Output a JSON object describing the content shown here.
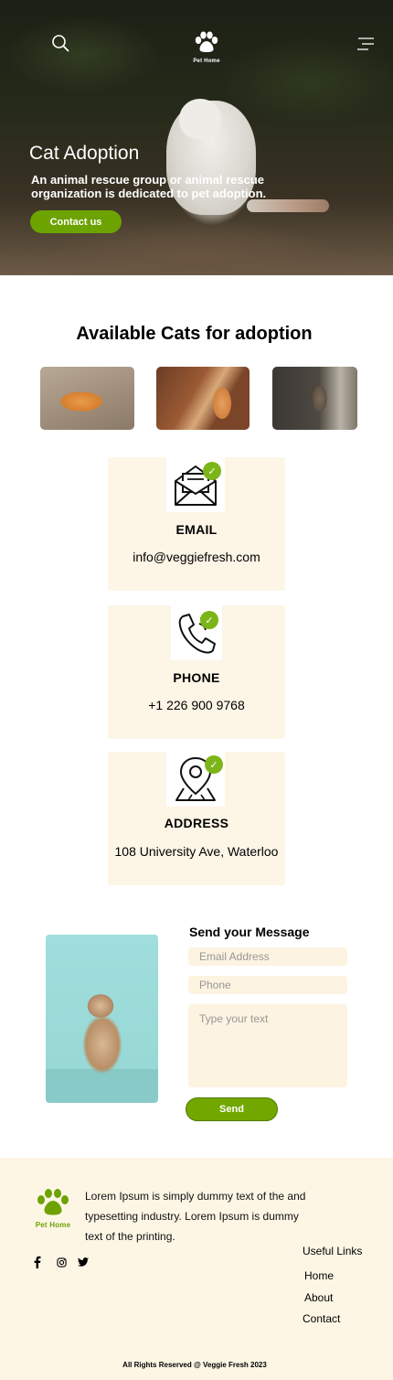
{
  "brand": {
    "name": "Pet Home"
  },
  "colors": {
    "accent": "#6ca300",
    "card_bg": "#fdf5e6",
    "footer_bg": "#fdf6e5"
  },
  "header": {
    "search_icon": "search-icon",
    "menu_icon": "hamburger-menu-icon",
    "logo_icon": "paw-icon"
  },
  "hero": {
    "title": "Cat Adoption",
    "subtitle": "An animal rescue group or animal rescue organization is dedicated to pet adoption.",
    "cta_label": "Contact us"
  },
  "adoption": {
    "title": "Available Cats for adoption"
  },
  "contact_cards": [
    {
      "icon": "envelope-icon",
      "title": "EMAIL",
      "value": "info@veggiefresh.com"
    },
    {
      "icon": "phone-icon",
      "title": "PHONE",
      "value": "+1 226 900 9768"
    },
    {
      "icon": "location-pin-icon",
      "title": "ADDRESS",
      "value": "108 University Ave, Waterloo"
    }
  ],
  "message_form": {
    "title": "Send your Message",
    "email_placeholder": "Email Address",
    "phone_placeholder": "Phone",
    "text_placeholder": "Type your text",
    "send_label": "Send"
  },
  "footer": {
    "description": "Lorem Ipsum is simply dummy text of the and typesetting industry. Lorem Ipsum is dummy text of the printing.",
    "social": [
      "facebook-icon",
      "instagram-icon",
      "twitter-icon"
    ],
    "links_title": "Useful Links",
    "links": [
      "Home",
      "About",
      "Contact"
    ],
    "copyright": "All Rights Reserved @ Veggie Fresh 2023"
  }
}
